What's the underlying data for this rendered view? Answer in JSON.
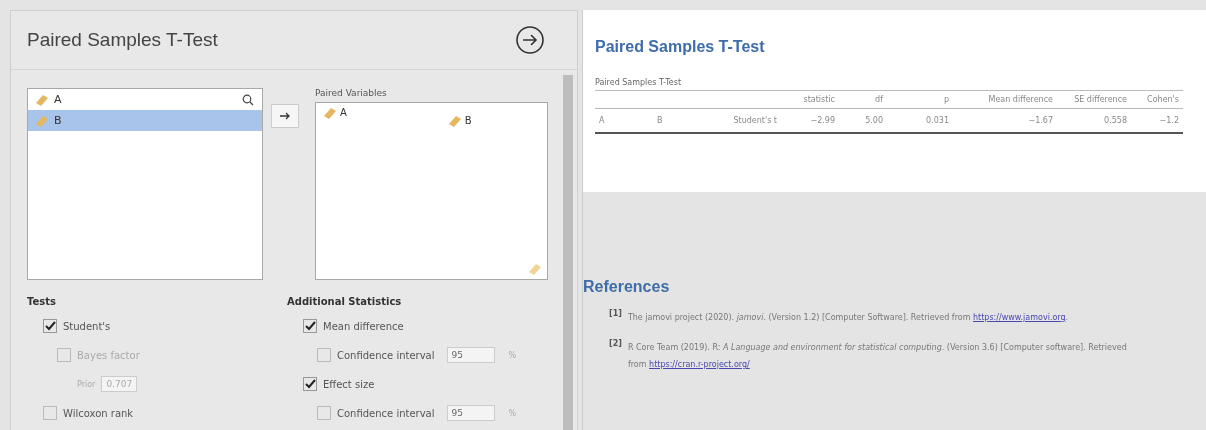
{
  "options_panel": {
    "title": "Paired Samples T-Test",
    "variables": [
      {
        "name": "A",
        "selected": false
      },
      {
        "name": "B",
        "selected": true
      }
    ],
    "paired_label": "Paired Variables",
    "pairs": [
      {
        "first": "A",
        "second": "B"
      }
    ],
    "tests": {
      "header": "Tests",
      "items": [
        {
          "kind": "check",
          "label": "Student's",
          "checked": true,
          "disabled": false
        },
        {
          "kind": "check",
          "label": "Bayes factor",
          "checked": false,
          "disabled": true
        },
        {
          "kind": "field",
          "label": "Prior",
          "value": "0.707",
          "disabled": true
        },
        {
          "kind": "check",
          "label": "Wilcoxon rank",
          "checked": false,
          "disabled": false
        }
      ]
    },
    "additional": {
      "header": "Additional Statistics",
      "items": [
        {
          "kind": "check",
          "label": "Mean difference",
          "checked": true
        },
        {
          "kind": "ci",
          "label": "Confidence interval",
          "checked": false,
          "value": "95",
          "unit": "%"
        },
        {
          "kind": "check",
          "label": "Effect size",
          "checked": true
        },
        {
          "kind": "ci",
          "label": "Confidence interval",
          "checked": false,
          "value": "95",
          "unit": "%"
        }
      ]
    }
  },
  "results": {
    "title": "Paired Samples T-Test",
    "table": {
      "title": "Paired Samples T-Test",
      "columns": [
        "",
        "",
        "",
        "statistic",
        "df",
        "p",
        "Mean difference",
        "SE difference",
        "Cohen's"
      ],
      "rows": [
        [
          "A",
          "B",
          "Student's t",
          "−2.99",
          "5.00",
          "0.031",
          "−1.67",
          "0.558",
          "−1.2"
        ]
      ]
    },
    "references_title": "References",
    "references": [
      {
        "number": "[1]",
        "text": "The jamovi project (2020). *jamovi*. (Version 1.2) [Computer Software]. Retrieved from",
        "link": "https://www.jamovi.org",
        "after": "."
      },
      {
        "number": "[2]",
        "text": "R Core Team (2019). R: *A Language and environment for statistical computing*. (Version 3.6) [Computer software]. Retrieved from",
        "link": "https://cran.r-project.org/"
      }
    ]
  }
}
